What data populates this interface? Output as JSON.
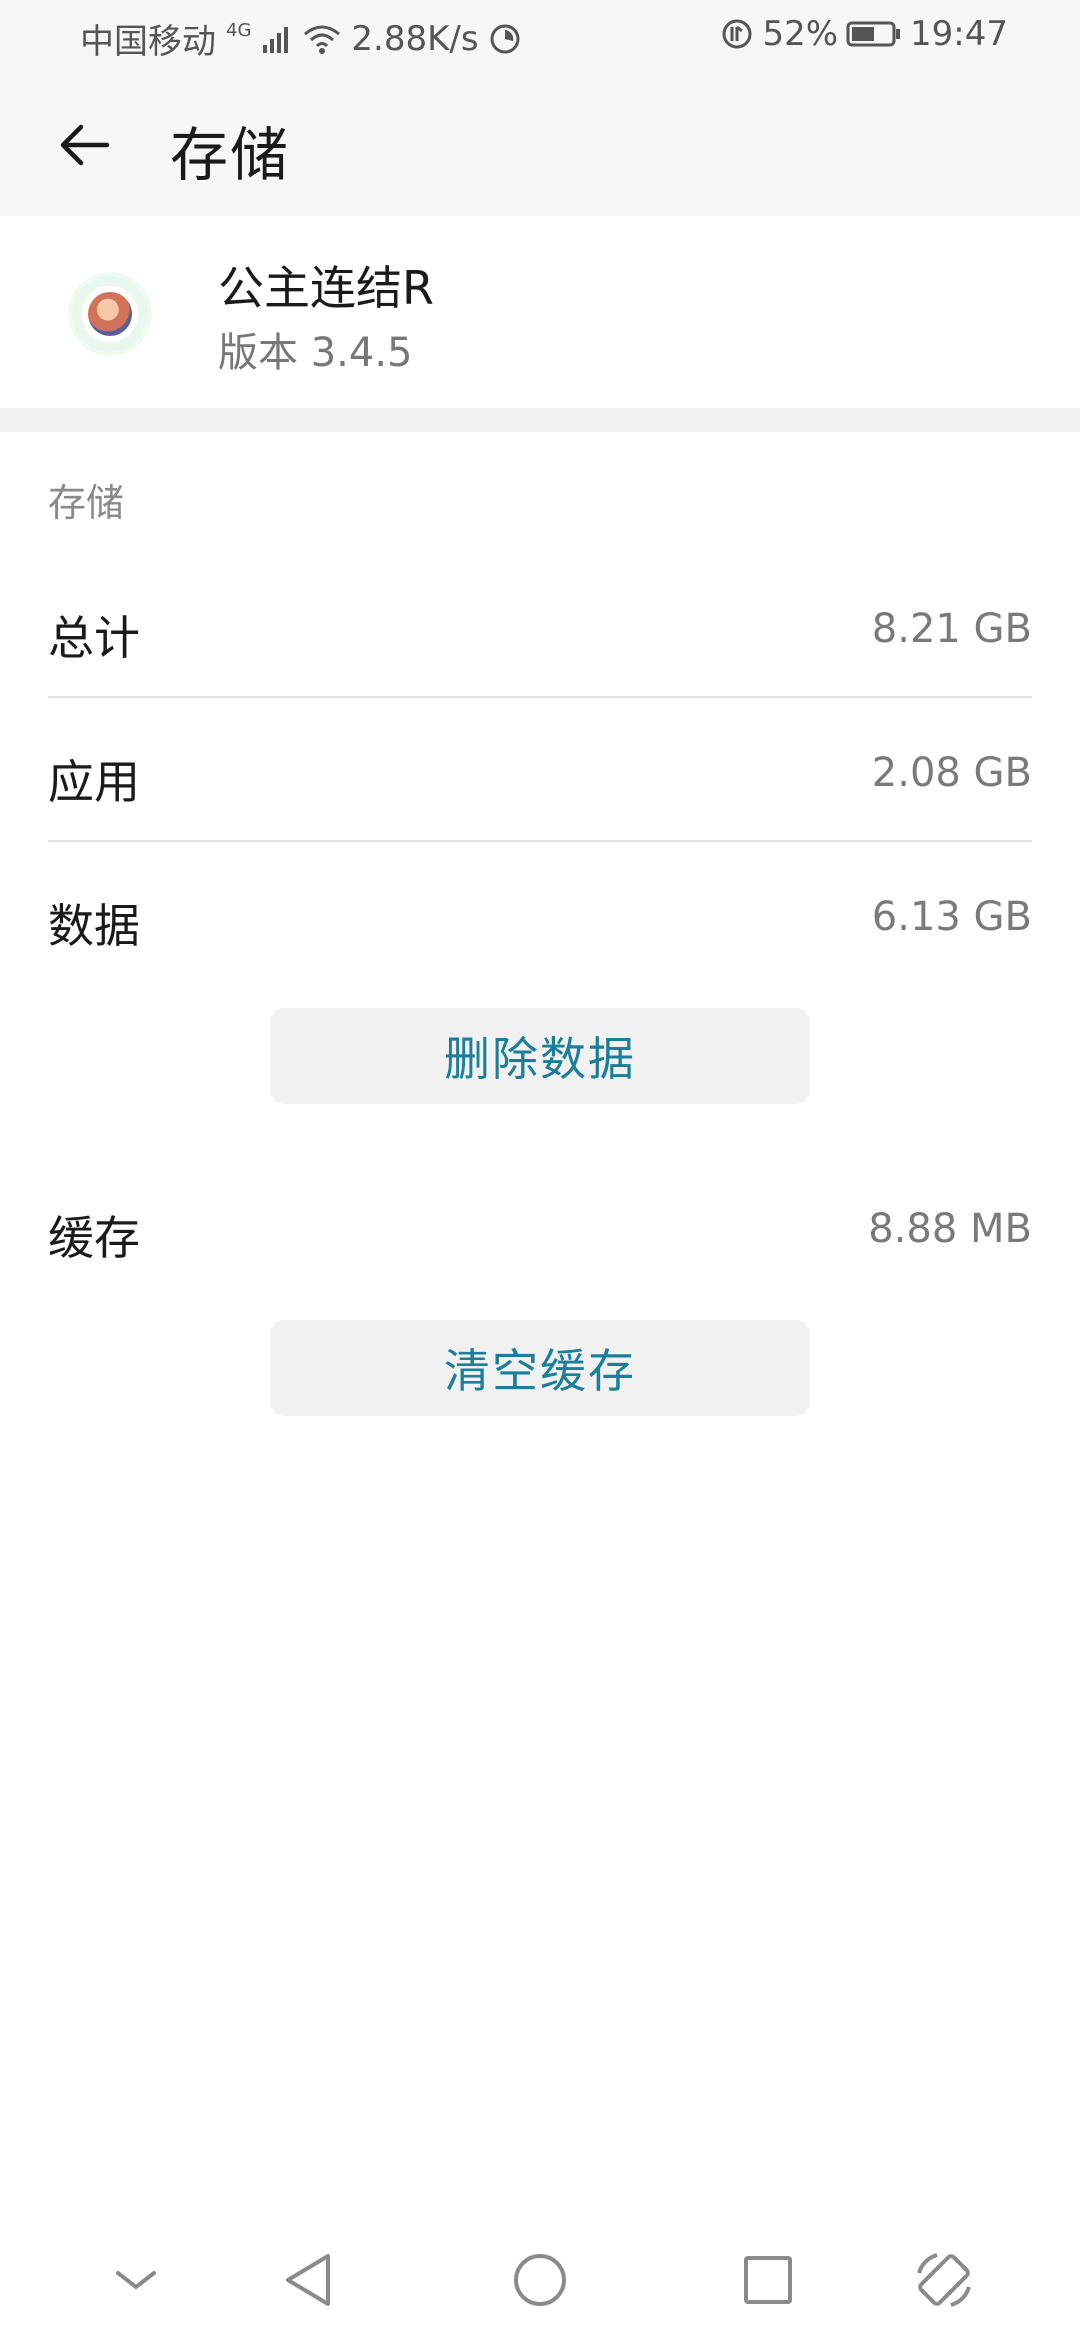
{
  "status_bar": {
    "carrier": "中国移动",
    "network_type": "4G",
    "speed": "2.88K/s",
    "battery": "52%",
    "time": "19:47"
  },
  "header": {
    "title": "存储",
    "back_icon": "arrow-left-icon"
  },
  "app": {
    "name": "公主连结R",
    "version": "版本 3.4.5"
  },
  "storage": {
    "section_label": "存储",
    "rows": [
      {
        "label": "总计",
        "value": "8.21 GB"
      },
      {
        "label": "应用",
        "value": "2.08 GB"
      },
      {
        "label": "数据",
        "value": "6.13 GB"
      }
    ],
    "delete_data_label": "删除数据",
    "cache": {
      "label": "缓存",
      "value": "8.88 MB"
    },
    "clear_cache_label": "清空缓存"
  },
  "colors": {
    "accent": "#1b7f99",
    "bar_bg": "#f7f7f7",
    "button_bg": "#f1f1f1"
  },
  "nav_bar": {
    "icons": [
      "chevron-down-icon",
      "back-triangle-icon",
      "home-circle-icon",
      "recents-square-icon",
      "rotate-screen-icon"
    ]
  }
}
